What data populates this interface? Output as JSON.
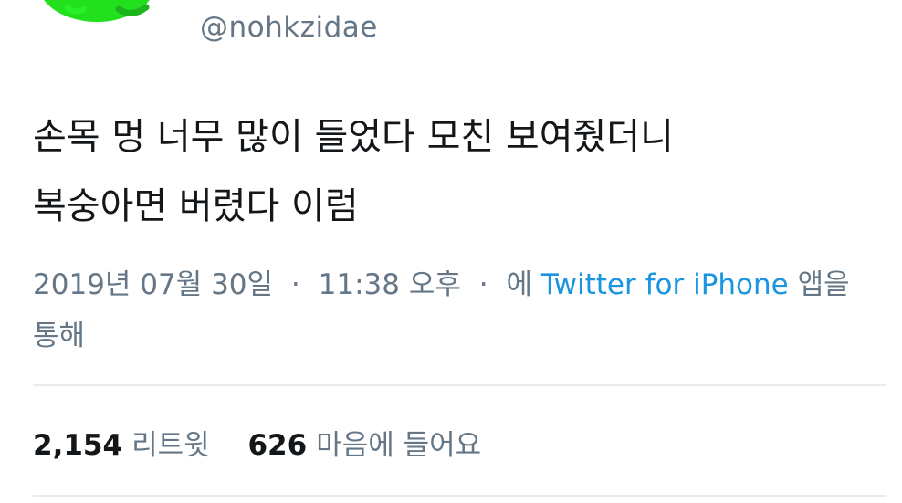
{
  "author": {
    "handle": "@nohkzidae",
    "avatar_color": "#22e01e"
  },
  "tweet": {
    "text_lines": [
      "손목 멍 너무 많이 들었다 모친 보여줬더니",
      "복숭아면 버렸다 이럼"
    ]
  },
  "meta": {
    "date": "2019년 07월 30일",
    "separator": "·",
    "time": "11:38 오후",
    "via_prefix": "에",
    "source": "Twitter for iPhone",
    "via_suffix_line1": "앱을",
    "via_suffix_line2": "통해",
    "link_color": "#1b95e0"
  },
  "stats": {
    "retweets_count": "2,154",
    "retweets_label": "리트윗",
    "likes_count": "626",
    "likes_label": "마음에 들어요"
  }
}
